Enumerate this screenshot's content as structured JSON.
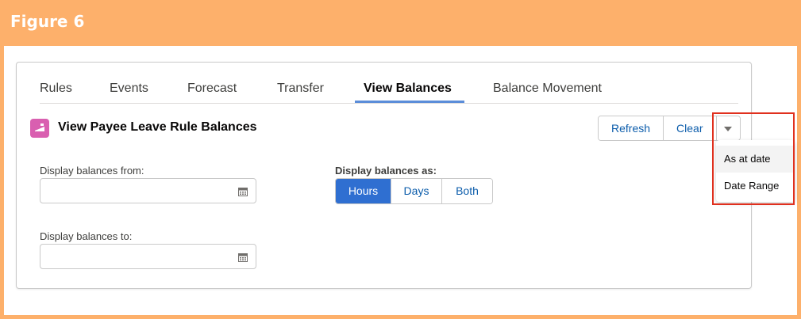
{
  "figure": {
    "title": "Figure 6"
  },
  "tabs": [
    {
      "label": "Rules",
      "active": false
    },
    {
      "label": "Events",
      "active": false
    },
    {
      "label": "Forecast",
      "active": false
    },
    {
      "label": "Transfer",
      "active": false
    },
    {
      "label": "View Balances",
      "active": true
    },
    {
      "label": "Balance Movement",
      "active": false
    }
  ],
  "panel": {
    "title": "View Payee Leave Rule Balances",
    "icon": "leave-rule-icon",
    "icon_color": "#d95fb0"
  },
  "actions": {
    "refresh_label": "Refresh",
    "clear_label": "Clear",
    "more_icon": "chevron-down-icon"
  },
  "menu": {
    "items": [
      {
        "label": "As at date",
        "hovered": true
      },
      {
        "label": "Date Range",
        "hovered": false
      }
    ]
  },
  "form": {
    "from_label": "Display balances from:",
    "from_value": "",
    "to_label": "Display balances to:",
    "to_value": "",
    "calendar_icon": "calendar-icon",
    "display_as_label": "Display balances as:",
    "display_as_options": [
      {
        "label": "Hours",
        "selected": true
      },
      {
        "label": "Days",
        "selected": false
      },
      {
        "label": "Both",
        "selected": false
      }
    ]
  },
  "colors": {
    "frame": "#fdb06b",
    "accent": "#2f6fd1",
    "link": "#0b5cab",
    "highlight": "#e0301e"
  }
}
